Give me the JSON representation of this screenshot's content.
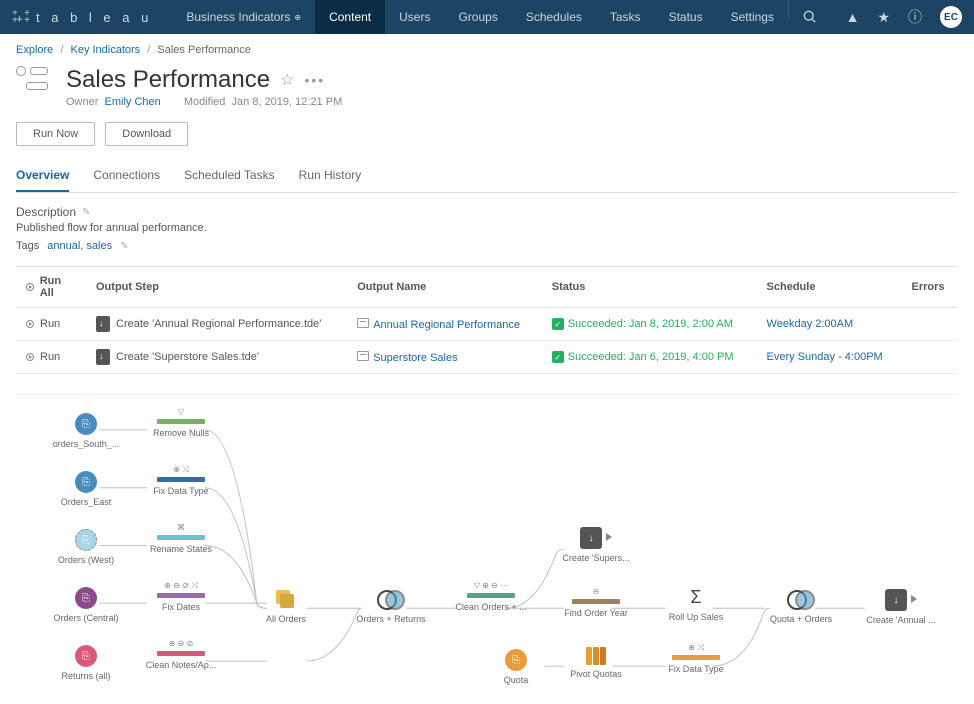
{
  "topbar": {
    "logo_text": "t a b l e a u",
    "workspace": "Business Indicators",
    "nav": [
      "Content",
      "Users",
      "Groups",
      "Schedules",
      "Tasks",
      "Status",
      "Settings"
    ],
    "avatar": "EC"
  },
  "breadcrumb": {
    "items": [
      "Explore",
      "Key Indicators"
    ],
    "current": "Sales Performance"
  },
  "header": {
    "title": "Sales Performance",
    "owner_label": "Owner",
    "owner": "Emily Chen",
    "modified_label": "Modified",
    "modified": "Jan 8, 2019, 12:21 PM"
  },
  "buttons": {
    "run_now": "Run Now",
    "download": "Download"
  },
  "tabs": [
    "Overview",
    "Connections",
    "Scheduled Tasks",
    "Run History"
  ],
  "description": {
    "label": "Description",
    "text": "Published flow for annual performance."
  },
  "tags": {
    "label": "Tags",
    "items": [
      "annual",
      "sales"
    ]
  },
  "table": {
    "run_all": "Run All",
    "headers": [
      "Output Step",
      "Output Name",
      "Status",
      "Schedule",
      "Errors"
    ],
    "rows": [
      {
        "run": "Run",
        "step": "Create 'Annual Regional Performance.tde'",
        "output": "Annual Regional Performance",
        "status": "Succeeded: Jan 8, 2019, 2:00 AM",
        "schedule": "Weekday 2:00AM"
      },
      {
        "run": "Run",
        "step": "Create 'Superstore Sales.tde'",
        "output": "Superstore Sales",
        "status": "Succeeded: Jan 6, 2019, 4:00 PM",
        "schedule": "Every Sunday - 4:00PM"
      }
    ]
  },
  "graph": {
    "nodes": {
      "orders_south": "orders_South_...",
      "orders_east": "Orders_East",
      "orders_west": "Orders (West)",
      "orders_central": "Orders (Central)",
      "returns": "Returns (all)",
      "remove_nulls": "Remove Nulls",
      "fix_data_type": "Fix Data Type",
      "rename_states": "Rename States",
      "fix_dates": "Fix Dates",
      "clean_notes": "Clean Notes/Ap...",
      "all_orders": "All Orders",
      "orders_returns": "Orders + Returns",
      "clean_orders": "Clean Orders + ...",
      "create_supers": "Create 'Supers...",
      "find_order_year": "Find Order Year",
      "roll_up_sales": "Roll Up Sales",
      "quota": "Quota",
      "pivot_quotas": "Pivot Quotas",
      "fix_data_type2": "Fix Data Type",
      "quota_orders": "Quota + Orders",
      "create_annual": "Create 'Annual ..."
    }
  }
}
